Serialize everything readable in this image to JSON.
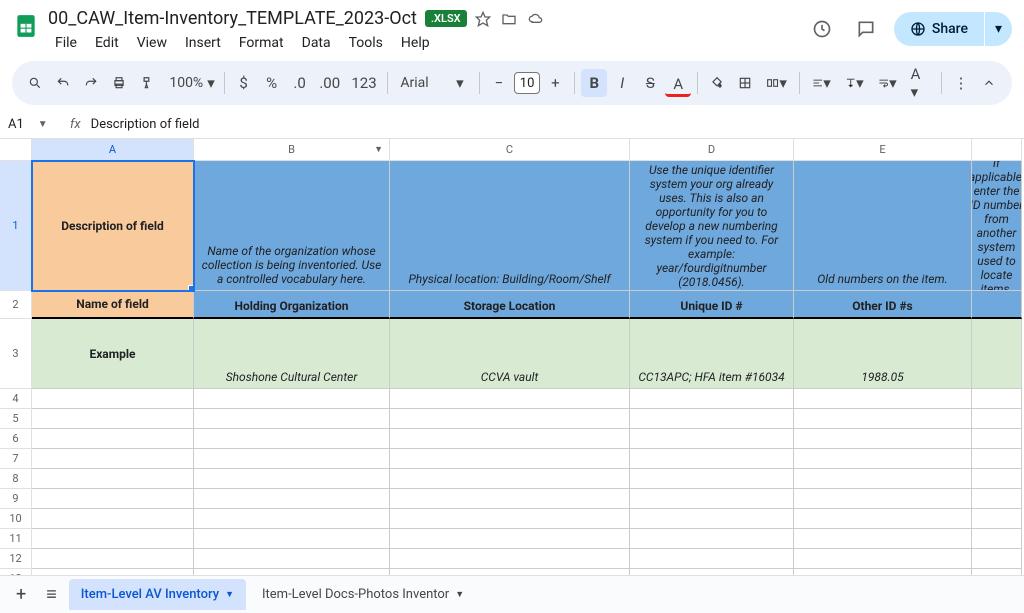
{
  "doc": {
    "title": "00_CAW_Item-Inventory_TEMPLATE_2023-Oct",
    "badge": ".XLSX"
  },
  "menu": [
    "File",
    "Edit",
    "View",
    "Insert",
    "Format",
    "Data",
    "Tools",
    "Help"
  ],
  "share": {
    "label": "Share"
  },
  "toolbar": {
    "zoom": "100%",
    "font": "Arial",
    "fontSize": "10"
  },
  "nameBox": "A1",
  "formula": "Description of field",
  "columns": [
    "A",
    "B",
    "C",
    "D",
    "E"
  ],
  "rows": {
    "header": {
      "a": "Description of field",
      "b": "Name of the organization whose collection is being inventoried. Use a controlled vocabulary here.",
      "c": "Physical location: Building/Room/Shelf",
      "d": "Use the unique identifier system your org already uses. This is also an opportunity for you to develop a new numbering system if you need to. For example: year/fourdigitnumber (2018.0456).",
      "e": "Old numbers on the item.",
      "f": "If applicable, enter the ID number from another system used to locate items."
    },
    "name": {
      "a": "Name of field",
      "b": "Holding Organization",
      "c": "Storage Location",
      "d": "Unique ID #",
      "e": "Other ID #s"
    },
    "example": {
      "a": "Example",
      "b": "Shoshone Cultural Center",
      "c": "CCVA vault",
      "d": "CC13APC; HFA item #16034",
      "e": "1988.05"
    }
  },
  "tabs": {
    "active": "Item-Level AV Inventory",
    "other": "Item-Level Docs-Photos Inventor"
  }
}
